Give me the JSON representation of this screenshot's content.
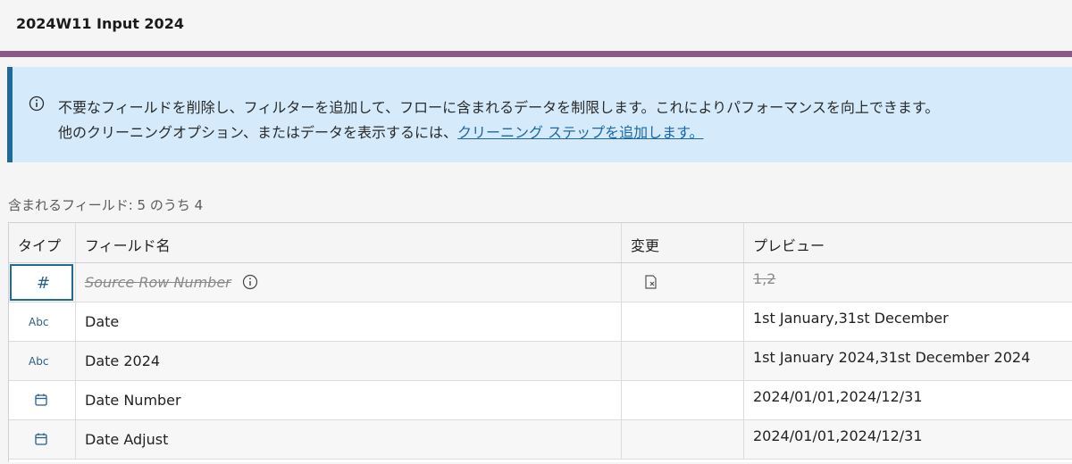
{
  "header": {
    "title": "2024W11 Input 2024"
  },
  "colors": {
    "accent_bar": "#8a5a86",
    "banner_bg": "#d5ebfb",
    "banner_border": "#1f6a99",
    "link": "#1b67a6",
    "type_icon": "#2a5f8a"
  },
  "banner": {
    "icon": "info-icon",
    "line1": "不要なフィールドを削除し、フィルターを追加して、フローに含まれるデータを制限します。これによりパフォーマンスを向上できます。",
    "line2_prefix": "他のクリーニングオプション、またはデータを表示するには、",
    "line2_link": "クリーニング ステップを追加します。"
  },
  "field_count": "含まれるフィールド: 5 のうち 4",
  "table": {
    "columns": {
      "type": "タイプ",
      "name": "フィールド名",
      "change": "変更",
      "preview": "プレビュー"
    },
    "rows": [
      {
        "type": "number",
        "type_icon": "hash-icon",
        "type_label": "#",
        "name": "Source Row Number",
        "removed": true,
        "has_info": true,
        "change_icon": "remove-field-icon",
        "preview": "1,2"
      },
      {
        "type": "string",
        "type_icon": "abc-icon",
        "type_label": "Abc",
        "name": "Date",
        "removed": false,
        "preview": "1st January,31st December"
      },
      {
        "type": "string",
        "type_icon": "abc-icon",
        "type_label": "Abc",
        "name": "Date 2024",
        "removed": false,
        "preview": "1st January 2024,31st December 2024"
      },
      {
        "type": "date",
        "type_icon": "calendar-icon",
        "name": "Date Number",
        "removed": false,
        "preview": "2024/01/01,2024/12/31"
      },
      {
        "type": "date",
        "type_icon": "calendar-icon",
        "name": "Date Adjust",
        "removed": false,
        "preview": "2024/01/01,2024/12/31"
      }
    ]
  }
}
